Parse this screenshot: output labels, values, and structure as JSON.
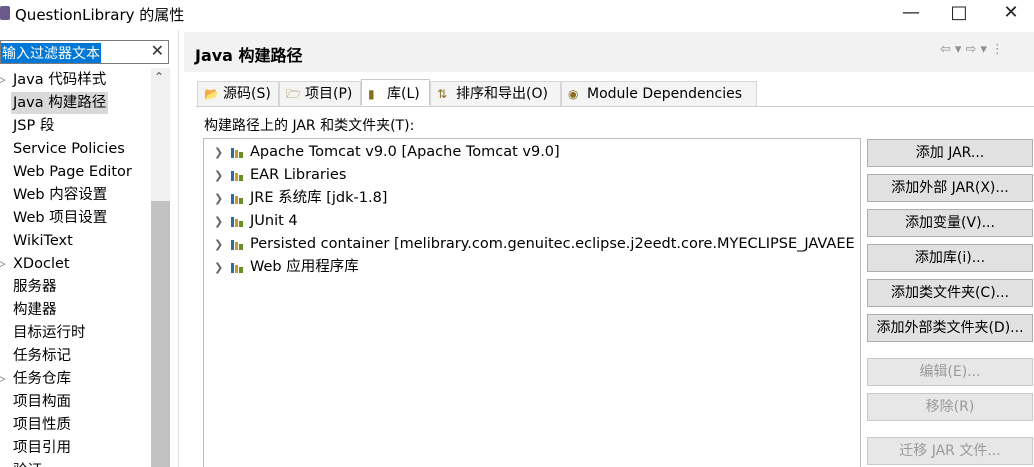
{
  "window": {
    "title": "QuestionLibrary 的属性",
    "min_icon": "minimize-icon",
    "max_icon": "maximize-icon",
    "close_icon": "close-icon"
  },
  "filter": {
    "value": "输入过滤器文本"
  },
  "tree": {
    "items": [
      {
        "label": "Java 代码样式",
        "expandable": true
      },
      {
        "label": "Java 构建路径",
        "selected": true
      },
      {
        "label": "JSP 段"
      },
      {
        "label": "Service Policies"
      },
      {
        "label": "Web Page Editor"
      },
      {
        "label": "Web 内容设置"
      },
      {
        "label": "Web 项目设置"
      },
      {
        "label": "WikiText"
      },
      {
        "label": "XDoclet",
        "expandable": true
      },
      {
        "label": "服务器"
      },
      {
        "label": "构建器"
      },
      {
        "label": "目标运行时"
      },
      {
        "label": "任务标记"
      },
      {
        "label": "任务仓库",
        "expandable": true
      },
      {
        "label": "项目构面"
      },
      {
        "label": "项目性质"
      },
      {
        "label": "项目引用"
      },
      {
        "label": "验证"
      }
    ]
  },
  "page": {
    "title": "Java 构建路径"
  },
  "tabs": [
    {
      "label": "源码(S)",
      "icon": "source-folder-icon"
    },
    {
      "label": "项目(P)",
      "icon": "project-folder-icon"
    },
    {
      "label": "库(L)",
      "icon": "library-icon",
      "active": true
    },
    {
      "label": "排序和导出(O)",
      "icon": "order-export-icon"
    },
    {
      "label": "Module Dependencies",
      "icon": "module-icon"
    }
  ],
  "section_label": "构建路径上的 JAR 和类文件夹(T):",
  "libraries": [
    "Apache Tomcat v9.0 [Apache Tomcat v9.0]",
    "EAR Libraries",
    "JRE 系统库 [jdk-1.8]",
    "JUnit 4",
    "Persisted container [melibrary.com.genuitec.eclipse.j2eedt.core.MYECLIPSE_JAVAEE",
    "Web 应用程序库"
  ],
  "buttons": [
    {
      "label": "添加 JAR...",
      "enabled": true
    },
    {
      "label": "添加外部 JAR(X)...",
      "enabled": true
    },
    {
      "label": "添加变量(V)...",
      "enabled": true
    },
    {
      "label": "添加库(i)...",
      "enabled": true
    },
    {
      "label": "添加类文件夹(C)...",
      "enabled": true
    },
    {
      "label": "添加外部类文件夹(D)...",
      "enabled": true
    },
    {
      "label": "编辑(E)...",
      "enabled": false
    },
    {
      "label": "移除(R)",
      "enabled": false
    },
    {
      "label": "迁移 JAR 文件...",
      "enabled": false
    }
  ],
  "colors": {
    "selection": "#0078d7",
    "tree_selected": "#d9d9d9",
    "library_icon": "#c79a2e"
  }
}
